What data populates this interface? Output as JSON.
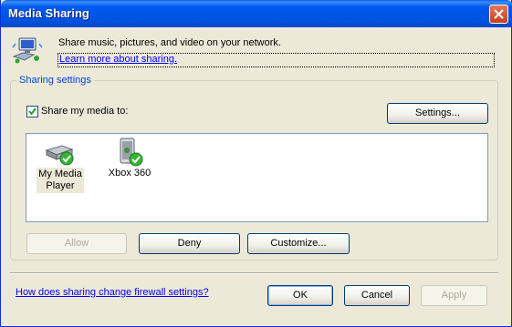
{
  "window": {
    "title": "Media Sharing"
  },
  "header": {
    "description": "Share music, pictures, and video on your network.",
    "learn_more": "Learn more about sharing."
  },
  "sharing": {
    "group_label": "Sharing settings",
    "share_label": "Share my media to:",
    "share_checked": true,
    "settings_button": "Settings..."
  },
  "devices": [
    {
      "name_line1": "My Media",
      "name_line2": "Player",
      "selected": true
    },
    {
      "name_line1": "Xbox 360",
      "name_line2": "",
      "selected": false
    }
  ],
  "actions": {
    "allow": "Allow",
    "deny": "Deny",
    "customize": "Customize..."
  },
  "footer": {
    "firewall_link": "How does sharing change firewall settings?",
    "ok": "OK",
    "cancel": "Cancel",
    "apply": "Apply"
  },
  "colors": {
    "title_bar": "#0054E3",
    "group_label": "#0046D5",
    "link": "#0000FF",
    "dialog_bg": "#ECE9D8"
  }
}
